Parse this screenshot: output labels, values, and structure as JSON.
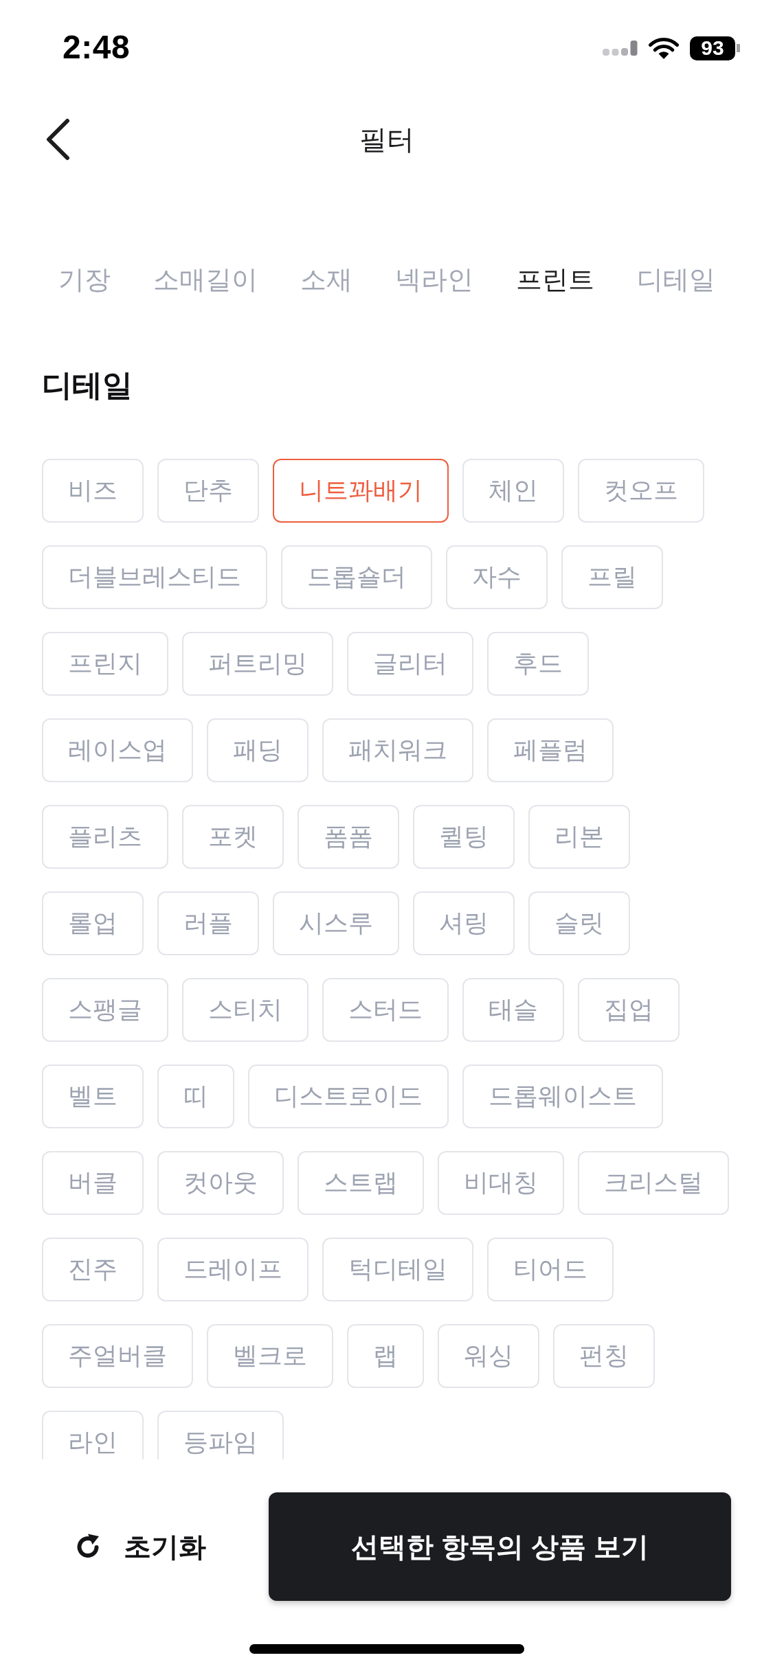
{
  "status_bar": {
    "time": "2:48",
    "battery": "93"
  },
  "header": {
    "title": "필터"
  },
  "tabs": [
    {
      "label": "기장",
      "selected": false
    },
    {
      "label": "소매길이",
      "selected": false
    },
    {
      "label": "소재",
      "selected": false
    },
    {
      "label": "넥라인",
      "selected": false
    },
    {
      "label": "프린트",
      "selected": true
    },
    {
      "label": "디테일",
      "selected": false
    }
  ],
  "section": {
    "title": "디테일",
    "chips": [
      {
        "label": "비즈",
        "selected": false
      },
      {
        "label": "단추",
        "selected": false
      },
      {
        "label": "니트꽈배기",
        "selected": true
      },
      {
        "label": "체인",
        "selected": false
      },
      {
        "label": "컷오프",
        "selected": false
      },
      {
        "label": "더블브레스티드",
        "selected": false
      },
      {
        "label": "드롭숄더",
        "selected": false
      },
      {
        "label": "자수",
        "selected": false
      },
      {
        "label": "프릴",
        "selected": false
      },
      {
        "label": "프린지",
        "selected": false
      },
      {
        "label": "퍼트리밍",
        "selected": false
      },
      {
        "label": "글리터",
        "selected": false
      },
      {
        "label": "후드",
        "selected": false
      },
      {
        "label": "레이스업",
        "selected": false
      },
      {
        "label": "패딩",
        "selected": false
      },
      {
        "label": "패치워크",
        "selected": false
      },
      {
        "label": "페플럼",
        "selected": false
      },
      {
        "label": "플리츠",
        "selected": false
      },
      {
        "label": "포켓",
        "selected": false
      },
      {
        "label": "폼폼",
        "selected": false
      },
      {
        "label": "퀼팅",
        "selected": false
      },
      {
        "label": "리본",
        "selected": false
      },
      {
        "label": "롤업",
        "selected": false
      },
      {
        "label": "러플",
        "selected": false
      },
      {
        "label": "시스루",
        "selected": false
      },
      {
        "label": "셔링",
        "selected": false
      },
      {
        "label": "슬릿",
        "selected": false
      },
      {
        "label": "스팽글",
        "selected": false
      },
      {
        "label": "스티치",
        "selected": false
      },
      {
        "label": "스터드",
        "selected": false
      },
      {
        "label": "태슬",
        "selected": false
      },
      {
        "label": "집업",
        "selected": false
      },
      {
        "label": "벨트",
        "selected": false
      },
      {
        "label": "띠",
        "selected": false
      },
      {
        "label": "디스트로이드",
        "selected": false
      },
      {
        "label": "드롭웨이스트",
        "selected": false
      },
      {
        "label": "버클",
        "selected": false
      },
      {
        "label": "컷아웃",
        "selected": false
      },
      {
        "label": "스트랩",
        "selected": false
      },
      {
        "label": "비대칭",
        "selected": false
      },
      {
        "label": "크리스털",
        "selected": false
      },
      {
        "label": "진주",
        "selected": false
      },
      {
        "label": "드레이프",
        "selected": false
      },
      {
        "label": "턱디테일",
        "selected": false
      },
      {
        "label": "티어드",
        "selected": false
      },
      {
        "label": "주얼버클",
        "selected": false
      },
      {
        "label": "벨크로",
        "selected": false
      },
      {
        "label": "랩",
        "selected": false
      },
      {
        "label": "워싱",
        "selected": false
      },
      {
        "label": "펀칭",
        "selected": false
      },
      {
        "label": "라인",
        "selected": false
      },
      {
        "label": "등파임",
        "selected": false
      }
    ]
  },
  "footer": {
    "reset_label": "초기화",
    "submit_label": "선택한 항목의 상품 보기"
  }
}
